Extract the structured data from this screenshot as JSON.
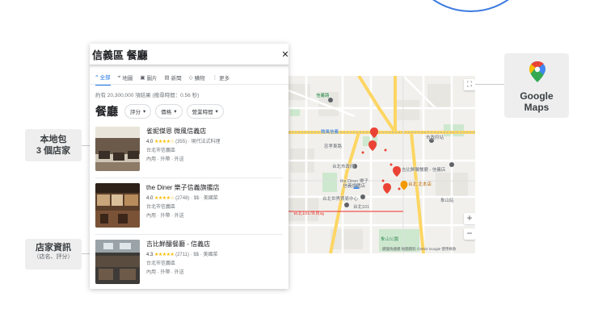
{
  "search": {
    "query": "信義區 餐廳",
    "clear": "✕"
  },
  "tabs": [
    {
      "label": "全部",
      "active": true
    },
    {
      "label": "地圖",
      "active": false
    },
    {
      "label": "圖片",
      "active": false
    },
    {
      "label": "新聞",
      "active": false
    },
    {
      "label": "購物",
      "active": false
    },
    {
      "label": "更多",
      "active": false
    }
  ],
  "results": {
    "stats": "約有 20,300,000 項結果 (搜尋時間：0.56 秒)"
  },
  "local": {
    "heading": "餐廳",
    "filters": [
      "評分",
      "價格",
      "營業時間"
    ],
    "listings": [
      {
        "name": "雀妮傑恩 微風信義店",
        "rating": "4.0",
        "stars": "★★★★☆",
        "count": "(355)",
        "category": " · 現代法式料理",
        "address": "台北市信義區",
        "services": "內用 · 外帶 · 外送"
      },
      {
        "name": "the Diner 樂子信義旗艦店",
        "rating": "4.0",
        "stars": "★★★★☆",
        "count": "(2748)",
        "category": " · $$ · 美國菜",
        "address": "台北市信義區",
        "services": "內用 · 外帶 · 外送"
      },
      {
        "name": "吉比鮮釀餐廳 - 信義店",
        "rating": "4.3",
        "stars": "★★★★★",
        "count": "(2711)",
        "category": " · $$ · 美國菜",
        "address": "台北市信義區",
        "services": "內用 · 外帶 · 外送"
      }
    ]
  },
  "labels": {
    "local_pack": "本地包",
    "local_pack_sub": "3 個店家",
    "info": "店家資訊",
    "info_sub": "（店名、評分）"
  },
  "brand": {
    "name": "Google\nMaps"
  },
  "map": {
    "labels": [
      "台北市政府",
      "台北101",
      "台北世界貿易中心",
      "象山公園",
      "吉比鮮釀餐廳 - 信義店",
      "the Diner 樂子",
      "信義旗艦店",
      "微風信義",
      "台北101/世貿站",
      "市政府站",
      "忠孝東路",
      "松仁路",
      "基隆路",
      "信義路",
      "象山站",
      "台北 北本店"
    ],
    "zoom_in": "+",
    "zoom_out": "−",
    "footer": "鍵盤快捷鍵  地圖資料 ©2022 Google  使用條款"
  },
  "colors": {
    "accent": "#1a73e8",
    "star": "#fbbc04",
    "pin": "#ea4335",
    "park": "#c8e6c9"
  }
}
